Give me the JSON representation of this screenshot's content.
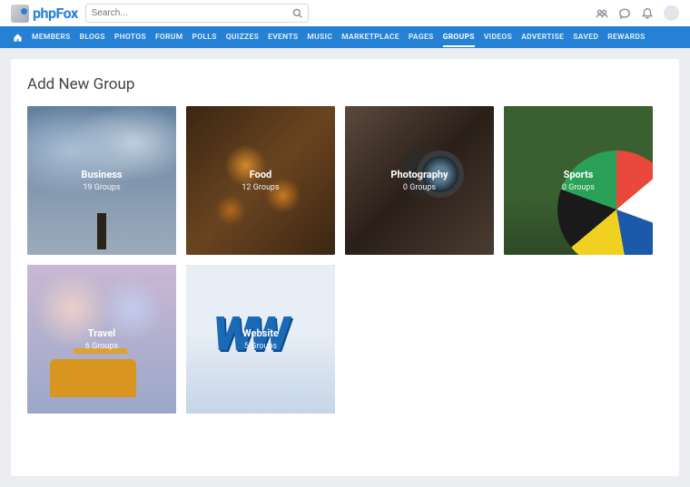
{
  "header": {
    "brand": "phpFox",
    "search_placeholder": "Search..."
  },
  "nav": [
    "MEMBERS",
    "BLOGS",
    "PHOTOS",
    "FORUM",
    "POLLS",
    "QUIZZES",
    "EVENTS",
    "MUSIC",
    "MARKETPLACE",
    "PAGES",
    "GROUPS",
    "VIDEOS",
    "ADVERTISE",
    "SAVED",
    "REWARDS"
  ],
  "nav_active": "GROUPS",
  "page": {
    "title": "Add New Group"
  },
  "categories": [
    {
      "name": "Business",
      "meta": "19 Groups",
      "bg": "bg-business"
    },
    {
      "name": "Food",
      "meta": "12 Groups",
      "bg": "bg-food"
    },
    {
      "name": "Photography",
      "meta": "0 Groups",
      "bg": "bg-photo"
    },
    {
      "name": "Sports",
      "meta": "0 Groups",
      "bg": "bg-sports"
    },
    {
      "name": "Travel",
      "meta": "6 Groups",
      "bg": "bg-travel"
    },
    {
      "name": "Website",
      "meta": "5 Groups",
      "bg": "bg-website"
    }
  ]
}
